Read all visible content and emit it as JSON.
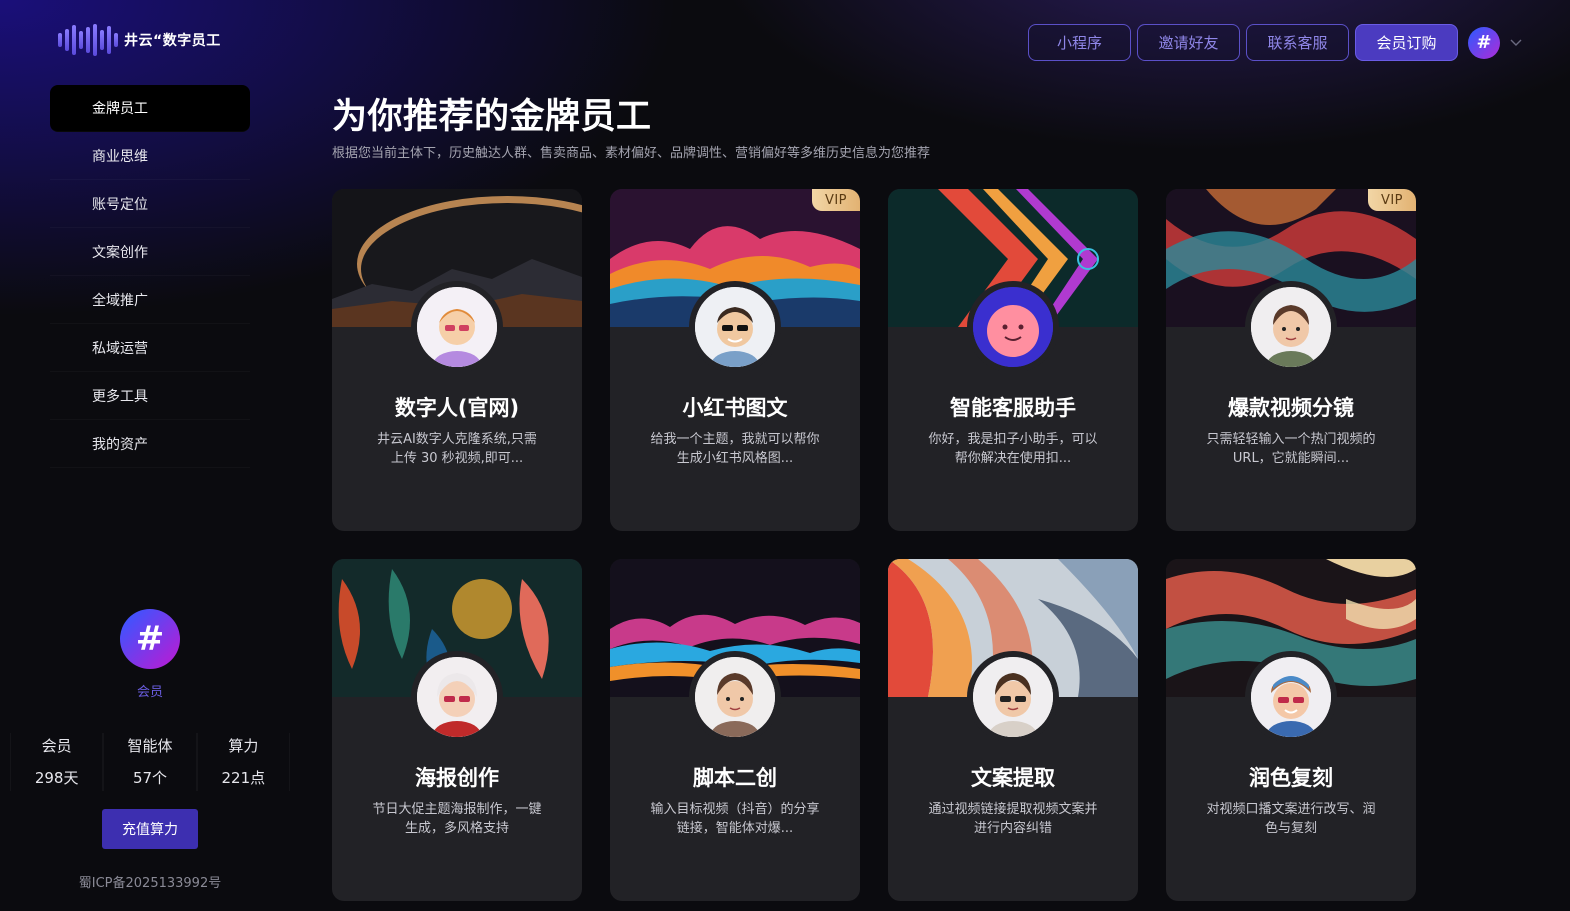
{
  "header": {
    "logo_text": "井云“数字员工",
    "buttons": [
      {
        "label": "小程序"
      },
      {
        "label": "邀请好友"
      },
      {
        "label": "联系客服"
      },
      {
        "label": "会员订购"
      }
    ],
    "avatar_symbol": "#"
  },
  "sidebar": {
    "items": [
      {
        "label": "金牌员工",
        "active": true
      },
      {
        "label": "商业思维"
      },
      {
        "label": "账号定位"
      },
      {
        "label": "文案创作"
      },
      {
        "label": "全域推广"
      },
      {
        "label": "私域运营"
      },
      {
        "label": "更多工具"
      },
      {
        "label": "我的资产"
      }
    ],
    "member_badge_symbol": "#",
    "member_label": "会员",
    "stats": [
      {
        "label": "会员",
        "value": "298天"
      },
      {
        "label": "智能体",
        "value": "57个"
      },
      {
        "label": "算力",
        "value": "221点"
      }
    ],
    "recharge_label": "充值算力",
    "icp": "蜀ICP备2025133992号"
  },
  "main": {
    "title": "为你推荐的金牌员工",
    "subtitle": "根据您当前主体下，历史触达人群、售卖商品、素材偏好、品牌调性、营销偏好等多维历史信息为您推荐",
    "vip_label": "VIP",
    "cards": [
      {
        "title": "数字人(官网)",
        "desc": "井云AI数字人克隆系统,只需上传 30 秒视频,即可...",
        "vip": false
      },
      {
        "title": "小红书图文",
        "desc": "给我一个主题，我就可以帮你生成小红书风格图...",
        "vip": true
      },
      {
        "title": "智能客服助手",
        "desc": "你好，我是扣子小助手，可以帮你解决在使用扣...",
        "vip": false
      },
      {
        "title": "爆款视频分镜",
        "desc": "只需轻轻输入一个热门视频的URL，它就能瞬间...",
        "vip": true
      },
      {
        "title": "海报创作",
        "desc": "节日大促主题海报制作，一键生成，多风格支持",
        "vip": false
      },
      {
        "title": "脚本二创",
        "desc": "输入目标视频（抖音）的分享链接，智能体对爆...",
        "vip": false
      },
      {
        "title": "文案提取",
        "desc": "通过视频链接提取视频文案并进行内容纠错",
        "vip": false
      },
      {
        "title": "润色复刻",
        "desc": "对视频口播文案进行改写、润色与复刻",
        "vip": false
      }
    ]
  }
}
